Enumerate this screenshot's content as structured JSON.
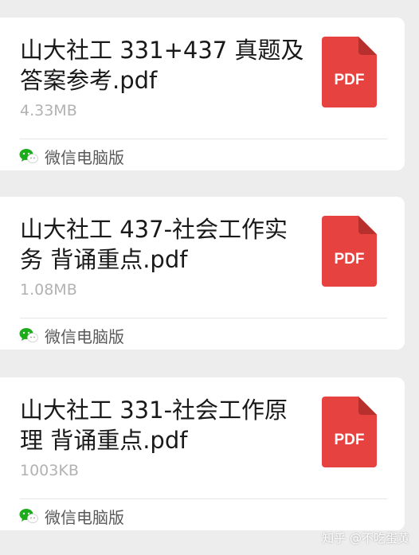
{
  "colors": {
    "background": "#ededed",
    "card": "#ffffff",
    "pdf_icon": "#e64340",
    "wechat_green": "#1aad19"
  },
  "messages": [
    {
      "file_name": "山大社工 331+437 真题及答案参考.pdf",
      "file_size": "4.33MB",
      "icon": "pdf-icon",
      "icon_label": "PDF",
      "source_icon": "wechat-icon",
      "source_label": "微信电脑版"
    },
    {
      "file_name": "山大社工 437-社会工作实务 背诵重点.pdf",
      "file_size": "1.08MB",
      "icon": "pdf-icon",
      "icon_label": "PDF",
      "source_icon": "wechat-icon",
      "source_label": "微信电脑版"
    },
    {
      "file_name": "山大社工 331-社会工作原理 背诵重点.pdf",
      "file_size": "1003KB",
      "icon": "pdf-icon",
      "icon_label": "PDF",
      "source_icon": "wechat-icon",
      "source_label": "微信电脑版"
    }
  ],
  "watermark": "知乎 @不吃蛋黄"
}
